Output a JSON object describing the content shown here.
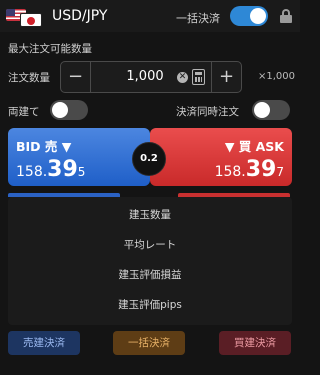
{
  "header": {
    "pair": "USD/JPY",
    "bulk_settle_label": "一括決済",
    "bulk_settle_on": true
  },
  "order": {
    "max_qty_label": "最大注文可能数量",
    "qty_label": "注文数量",
    "qty_value": "1,000",
    "minus": "−",
    "plus": "+",
    "clear": "✕",
    "unit": "×1,000"
  },
  "options": {
    "hedge_label": "両建て",
    "hedge_on": false,
    "simul_settle_label": "決済同時注文",
    "simul_settle_on": false
  },
  "quote": {
    "bid_label": "BID 売 ▼",
    "bid_main": "158.",
    "bid_big": "39",
    "bid_small": "5",
    "ask_label": "▼ 買 ASK",
    "ask_main": "158.",
    "ask_big": "39",
    "ask_small": "7",
    "spread": "0.2"
  },
  "positions": {
    "rows": [
      "建玉数量",
      "平均レート",
      "建玉評価損益",
      "建玉評価pips"
    ]
  },
  "actions": {
    "sell_settle": "売建決済",
    "bulk_settle": "一括決済",
    "buy_settle": "買建決済"
  }
}
